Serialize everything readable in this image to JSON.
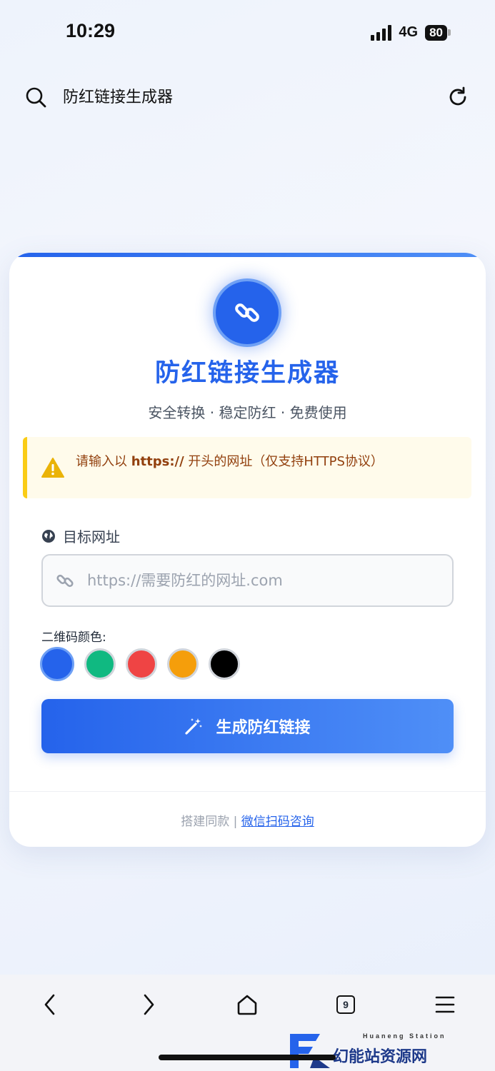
{
  "status_bar": {
    "time": "10:29",
    "network": "4G",
    "battery": "80"
  },
  "browser": {
    "address_text": "防红链接生成器"
  },
  "card": {
    "title": "防红链接生成器",
    "subtitle": "安全转换 · 稳定防红 · 免费使用",
    "notice": {
      "prefix": "请输入以 ",
      "highlight": "https://",
      "suffix": " 开头的网址（仅支持HTTPS协议）"
    },
    "target_label": "目标网址",
    "url_placeholder": "https://需要防红的网址.com",
    "color_label": "二维码颜色:",
    "colors": [
      "#2563eb",
      "#10b981",
      "#ef4444",
      "#f59e0b",
      "#000000"
    ],
    "selected_color_index": 0,
    "generate_button": "生成防红链接",
    "footer_prefix": "搭建同款 | ",
    "footer_link": "微信扫码咨询"
  },
  "bottom_nav": {
    "tabs_count": "9"
  },
  "watermark": {
    "text": "幻能站资源网",
    "sub": "Huaneng Station"
  },
  "theme": {
    "accent": "#2563eb",
    "notice_bg": "#fffbeb",
    "notice_border": "#facc15"
  }
}
